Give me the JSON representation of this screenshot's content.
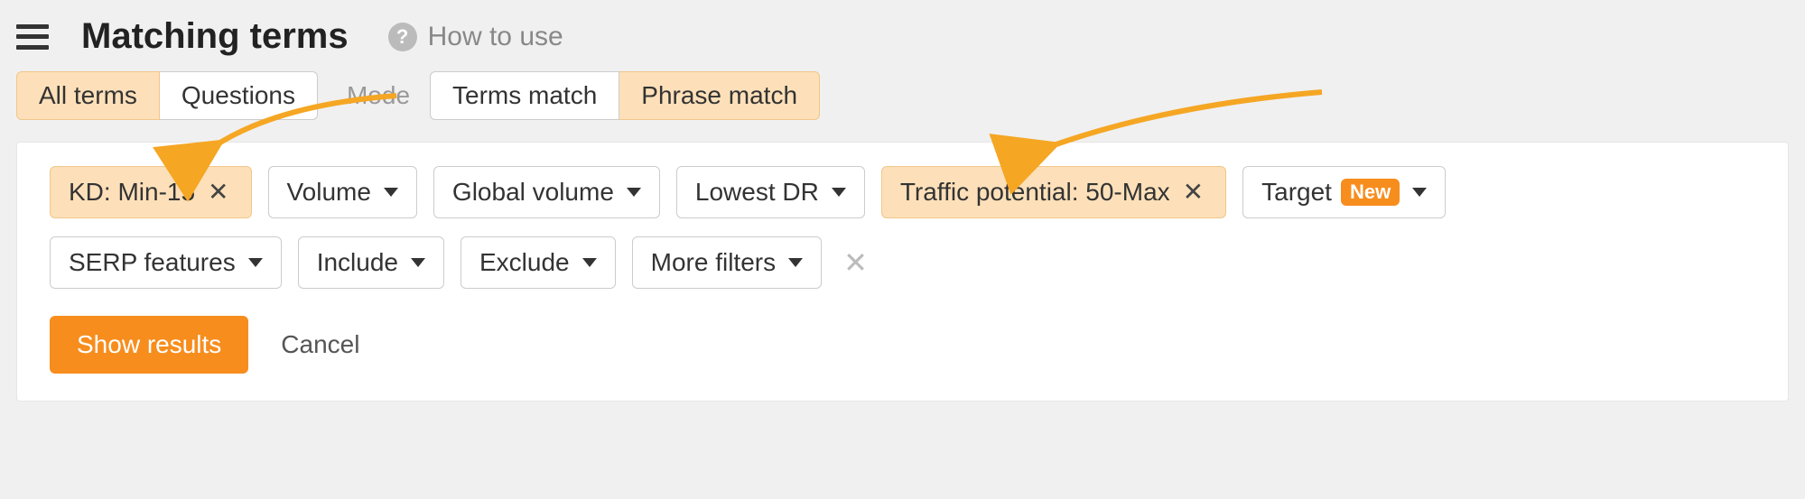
{
  "header": {
    "title": "Matching terms",
    "how_to_use": "How to use"
  },
  "tabs": {
    "terms_questions": [
      "All terms",
      "Questions"
    ],
    "terms_questions_active": 0,
    "mode_label": "Mode",
    "match_types": [
      "Terms match",
      "Phrase match"
    ],
    "match_types_active": 1
  },
  "filters": {
    "row1": [
      {
        "label": "KD: Min-15",
        "active": true,
        "closable": true,
        "name": "filter-kd"
      },
      {
        "label": "Volume",
        "dropdown": true,
        "name": "filter-volume"
      },
      {
        "label": "Global volume",
        "dropdown": true,
        "name": "filter-global-volume"
      },
      {
        "label": "Lowest DR",
        "dropdown": true,
        "name": "filter-lowest-dr"
      },
      {
        "label": "Traffic potential: 50-Max",
        "active": true,
        "closable": true,
        "name": "filter-traffic-potential"
      },
      {
        "label": "Target",
        "dropdown": true,
        "badge": "New",
        "name": "filter-target"
      }
    ],
    "row2": [
      {
        "label": "SERP features",
        "dropdown": true,
        "name": "filter-serp-features"
      },
      {
        "label": "Include",
        "dropdown": true,
        "name": "filter-include"
      },
      {
        "label": "Exclude",
        "dropdown": true,
        "name": "filter-exclude"
      },
      {
        "label": "More filters",
        "dropdown": true,
        "name": "filter-more"
      }
    ]
  },
  "actions": {
    "show_results": "Show results",
    "cancel": "Cancel"
  },
  "colors": {
    "accent": "#f78d1d",
    "highlight": "#fde0b9"
  }
}
